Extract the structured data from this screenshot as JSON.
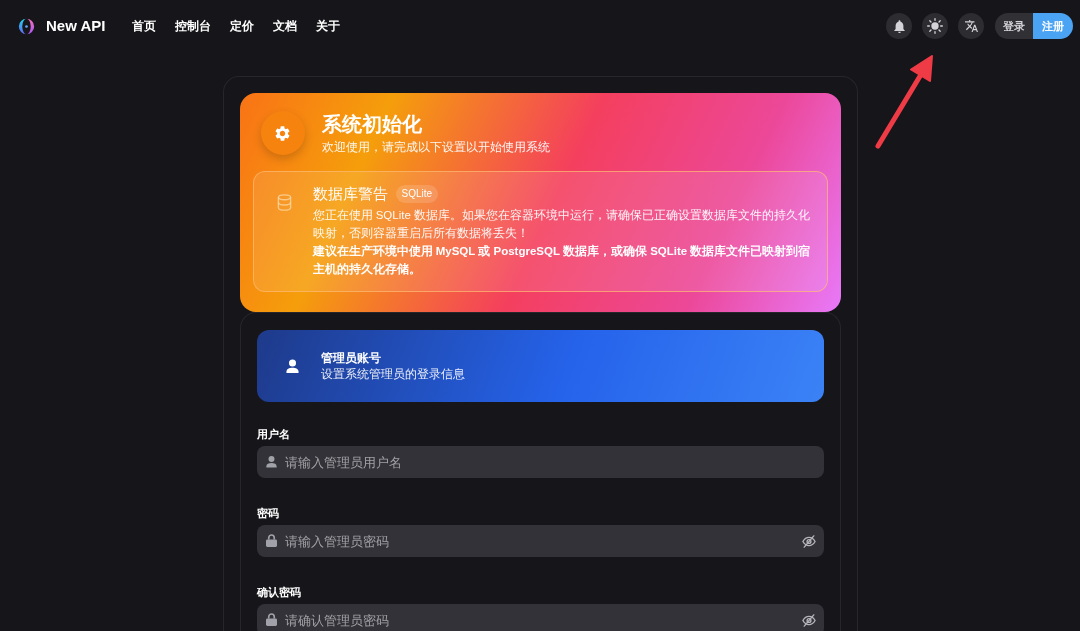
{
  "nav": {
    "brand": "New API",
    "links": [
      "首页",
      "控制台",
      "定价",
      "文档",
      "关于"
    ]
  },
  "auth": {
    "login": "登录",
    "register": "注册"
  },
  "setup": {
    "title": "系统初始化",
    "subtitle": "欢迎使用，请完成以下设置以开始使用系统",
    "warning": {
      "title": "数据库警告",
      "badge": "SQLite",
      "message": "您正在使用 SQLite 数据库。如果您在容器环境中运行，请确保已正确设置数据库文件的持久化映射，否则容器重启后所有数据将丢失！",
      "advice": "建议在生产环境中使用 MySQL 或 PostgreSQL 数据库，或确保 SQLite 数据库文件已映射到宿主机的持久化存储。"
    }
  },
  "admin_section": {
    "title": "管理员账号",
    "subtitle": "设置系统管理员的登录信息"
  },
  "fields": [
    {
      "kind": "text",
      "label": "用户名",
      "placeholder": "请输入管理员用户名"
    },
    {
      "kind": "password",
      "label": "密码",
      "placeholder": "请输入管理员密码"
    },
    {
      "kind": "password",
      "label": "确认密码",
      "placeholder": "请确认管理员密码"
    }
  ]
}
